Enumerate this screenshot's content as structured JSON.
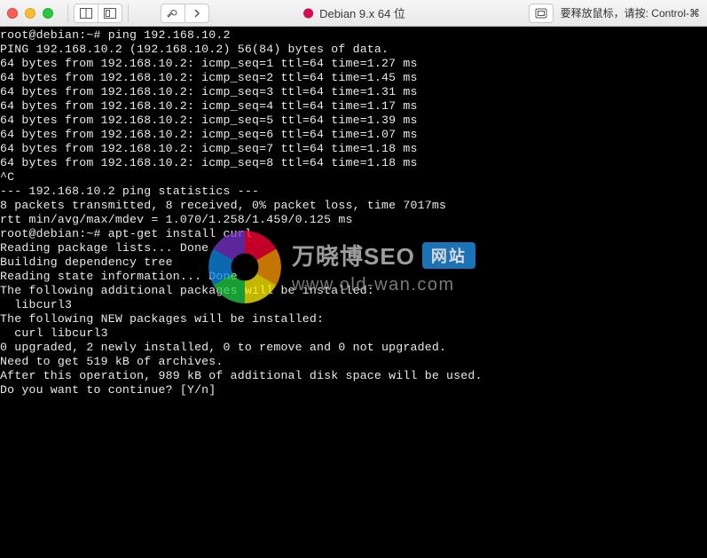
{
  "titlebar": {
    "title": "Debian 9.x 64 位",
    "hint": "要释放鼠标，请按: Control-⌘",
    "icons": {
      "close": "close-icon",
      "min": "minimize-icon",
      "zoom": "zoom-icon",
      "columns": "view-columns-icon",
      "layout": "layout-icon",
      "wrench": "wrench-icon",
      "chevron": "chevron-right-icon",
      "debian": "debian-icon",
      "box": "screenshot-icon"
    }
  },
  "terminal": {
    "prompt": "root@debian:~#",
    "cmd_ping": "ping 192.168.10.2",
    "head": "PING 192.168.10.2 (192.168.10.2) 56(84) bytes of data.",
    "ping_from": "64 bytes from 192.168.10.2:",
    "seqs": [
      {
        "seq": 1,
        "ttl": 64,
        "time": "1.27"
      },
      {
        "seq": 2,
        "ttl": 64,
        "time": "1.45"
      },
      {
        "seq": 3,
        "ttl": 64,
        "time": "1.31"
      },
      {
        "seq": 4,
        "ttl": 64,
        "time": "1.17"
      },
      {
        "seq": 5,
        "ttl": 64,
        "time": "1.39"
      },
      {
        "seq": 6,
        "ttl": 64,
        "time": "1.07"
      },
      {
        "seq": 7,
        "ttl": 64,
        "time": "1.18"
      },
      {
        "seq": 8,
        "ttl": 64,
        "time": "1.18"
      }
    ],
    "break": "^C",
    "stats_head": "--- 192.168.10.2 ping statistics ---",
    "stats_pkts": "8 packets transmitted, 8 received, 0% packet loss, time 7017ms",
    "stats_rtt": "rtt min/avg/max/mdev = 1.070/1.258/1.459/0.125 ms",
    "cmd_apt": "apt-get install curl",
    "apt": {
      "l1": "Reading package lists... Done",
      "l2": "Building dependency tree",
      "l3": "Reading state information... Done",
      "l4": "The following additional packages will be installed:",
      "l5": "  libcurl3",
      "l6": "The following NEW packages will be installed:",
      "l7": "  curl libcurl3",
      "l8": "0 upgraded, 2 newly installed, 0 to remove and 0 not upgraded.",
      "l9": "Need to get 519 kB of archives.",
      "l10": "After this operation, 989 kB of additional disk space will be used.",
      "l11": "Do you want to continue? [Y/n]"
    }
  },
  "watermark": {
    "title": "万晓博SEO",
    "badge": "网站",
    "url": "www.old-wan.com"
  }
}
